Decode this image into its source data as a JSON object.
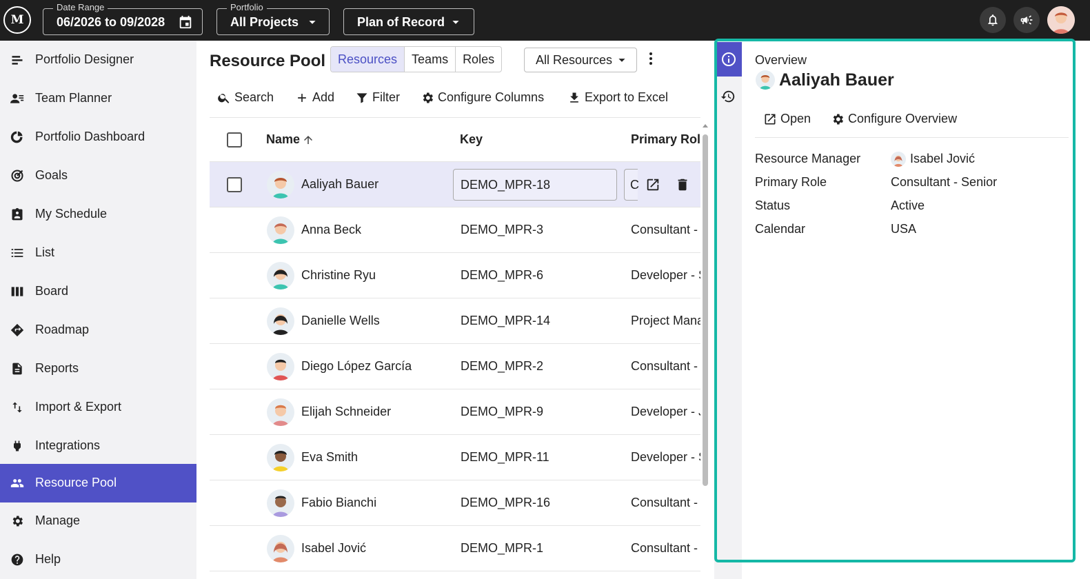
{
  "topbar": {
    "logo_text": "M",
    "date_range": {
      "caption": "Date Range",
      "value": "06/2026 to 09/2028"
    },
    "portfolio": {
      "caption": "Portfolio",
      "value": "All Projects"
    },
    "plan": {
      "value": "Plan of Record"
    },
    "icons": [
      "calendar-icon",
      "chevron-down-icon",
      "bell-icon",
      "megaphone-icon",
      "avatar"
    ]
  },
  "sidebar": {
    "items": [
      {
        "label": "Portfolio Designer",
        "icon": "designer-icon"
      },
      {
        "label": "Team Planner",
        "icon": "team-planner-icon"
      },
      {
        "label": "Portfolio Dashboard",
        "icon": "dashboard-icon"
      },
      {
        "label": "Goals",
        "icon": "goals-icon"
      },
      {
        "label": "My Schedule",
        "icon": "schedule-icon"
      },
      {
        "label": "List",
        "icon": "list-icon"
      },
      {
        "label": "Board",
        "icon": "board-icon"
      },
      {
        "label": "Roadmap",
        "icon": "roadmap-icon"
      },
      {
        "label": "Reports",
        "icon": "reports-icon"
      },
      {
        "label": "Import & Export",
        "icon": "import-export-icon"
      },
      {
        "label": "Integrations",
        "icon": "plug-icon"
      },
      {
        "label": "Resource Pool",
        "icon": "people-icon",
        "active": true
      },
      {
        "label": "Manage",
        "icon": "gear-icon"
      },
      {
        "label": "Help",
        "icon": "help-icon"
      }
    ],
    "active_color": "#5051c6"
  },
  "main": {
    "title": "Resource Pool",
    "tabs": [
      {
        "label": "Resources",
        "active": true
      },
      {
        "label": "Teams"
      },
      {
        "label": "Roles"
      }
    ],
    "filter_select": "All Resources",
    "toolbar": {
      "search": "Search",
      "add": "Add",
      "filter": "Filter",
      "configure_columns": "Configure Columns",
      "export": "Export to Excel"
    },
    "grid": {
      "columns": [
        "Name",
        "Key",
        "Primary Role"
      ],
      "rows": [
        {
          "name": "Aaliyah Bauer",
          "key": "DEMO_MPR-18",
          "role": "C",
          "selected": true
        },
        {
          "name": "Anna Beck",
          "key": "DEMO_MPR-3",
          "role": "Consultant -"
        },
        {
          "name": "Christine Ryu",
          "key": "DEMO_MPR-6",
          "role": "Developer - S"
        },
        {
          "name": "Danielle Wells",
          "key": "DEMO_MPR-14",
          "role": "Project Mana"
        },
        {
          "name": "Diego López García",
          "key": "DEMO_MPR-2",
          "role": "Consultant -"
        },
        {
          "name": "Elijah Schneider",
          "key": "DEMO_MPR-9",
          "role": "Developer - J"
        },
        {
          "name": "Eva Smith",
          "key": "DEMO_MPR-11",
          "role": "Developer - S"
        },
        {
          "name": "Fabio Bianchi",
          "key": "DEMO_MPR-16",
          "role": "Consultant -"
        },
        {
          "name": "Isabel Jović",
          "key": "DEMO_MPR-1",
          "role": "Consultant -"
        }
      ]
    }
  },
  "panel": {
    "section": "Overview",
    "name": "Aaliyah Bauer",
    "open": "Open",
    "configure": "Configure Overview",
    "fields": [
      {
        "label": "Resource Manager",
        "value": "Isabel Jović"
      },
      {
        "label": "Primary Role",
        "value": "Consultant - Senior"
      },
      {
        "label": "Status",
        "value": "Active"
      },
      {
        "label": "Calendar",
        "value": "USA"
      }
    ],
    "frame_color": "#15b8a6"
  }
}
